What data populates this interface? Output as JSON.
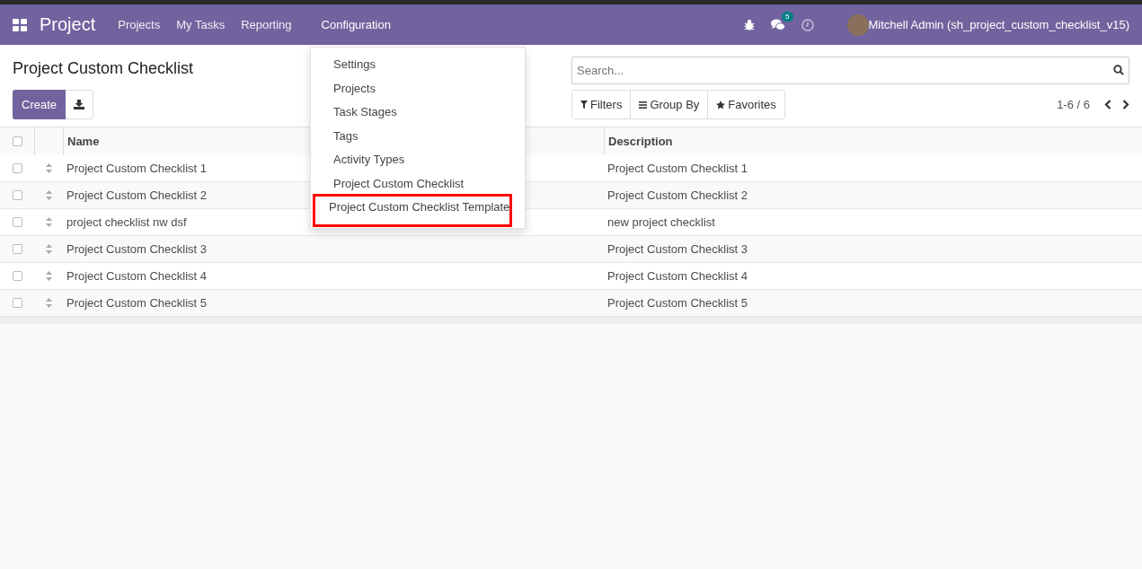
{
  "navbar": {
    "app_title": "Project",
    "menu": [
      {
        "label": "Projects",
        "selected": false
      },
      {
        "label": "My Tasks",
        "selected": false
      },
      {
        "label": "Reporting",
        "selected": false
      },
      {
        "label": "Configuration",
        "selected": true
      }
    ],
    "message_count": "5",
    "user": "Mitchell Admin (sh_project_custom_checklist_v15)"
  },
  "control_panel": {
    "title": "Project Custom Checklist",
    "create_button": "Create",
    "search": {
      "placeholder": "Search..."
    },
    "filters": [
      "Filters",
      "Group By",
      "Favorites"
    ],
    "pager": "1-6 / 6"
  },
  "table": {
    "select_all_checked": false,
    "columns": [
      "Name",
      "Description"
    ],
    "rows": [
      {
        "checked": false,
        "name": "Project Custom Checklist 1",
        "description": "Project Custom Checklist 1"
      },
      {
        "checked": false,
        "name": "Project Custom Checklist 2",
        "description": "Project Custom Checklist 2"
      },
      {
        "checked": false,
        "name": "project checklist nw dsf",
        "description": "new project checklist"
      },
      {
        "checked": false,
        "name": "Project Custom Checklist 3",
        "description": "Project Custom Checklist 3"
      },
      {
        "checked": false,
        "name": "Project Custom Checklist 4",
        "description": "Project Custom Checklist 4"
      },
      {
        "checked": false,
        "name": "Project Custom Checklist 5",
        "description": "Project Custom Checklist 5"
      }
    ]
  },
  "configuration_menu": {
    "items": [
      {
        "label": "Settings",
        "highlighted": false
      },
      {
        "label": "Projects",
        "highlighted": false
      },
      {
        "label": "Task Stages",
        "highlighted": false
      },
      {
        "label": "Tags",
        "highlighted": false
      },
      {
        "label": "Activity Types",
        "highlighted": false
      },
      {
        "label": "Project Custom Checklist",
        "highlighted": false
      },
      {
        "label": "Project Custom Checklist Template",
        "highlighted": true
      }
    ]
  }
}
